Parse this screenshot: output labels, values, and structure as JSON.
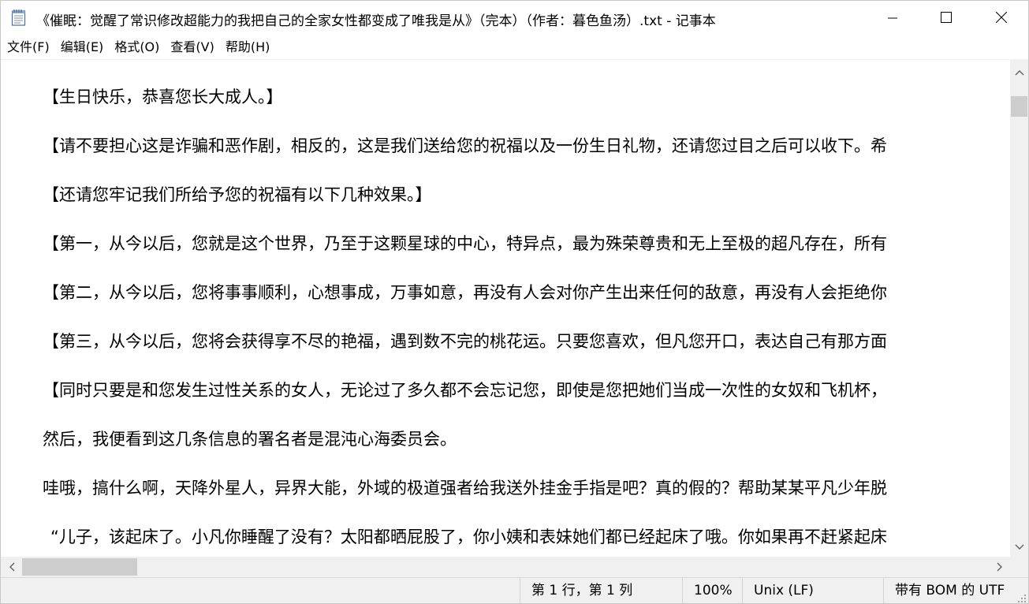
{
  "window": {
    "title": "《催眠：觉醒了常识修改超能力的我把自己的全家女性都变成了唯我是从》（完本）（作者：暮色鱼汤）.txt - 记事本",
    "controls": {
      "minimize": "minimize-icon",
      "maximize": "maximize-icon",
      "close": "close-icon"
    }
  },
  "menu": {
    "items": [
      {
        "label": "文件(F)"
      },
      {
        "label": "编辑(E)"
      },
      {
        "label": "格式(O)"
      },
      {
        "label": "查看(V)"
      },
      {
        "label": "帮助(H)"
      }
    ]
  },
  "editor": {
    "lines": [
      "【生日快乐，恭喜您长大成人。】",
      "【请不要担心这是诈骗和恶作剧，相反的，这是我们送给您的祝福以及一份生日礼物，还请您过目之后可以收下。希",
      "【还请您牢记我们所给予您的祝福有以下几种效果。】",
      "【第一，从今以后，您就是这个世界，乃至于这颗星球的中心，特异点，最为殊荣尊贵和无上至极的超凡存在，所有",
      "【第二，从今以后，您将事事顺利，心想事成，万事如意，再没有人会对你产生出来任何的敌意，再没有人会拒绝你",
      "【第三，从今以后，您将会获得享不尽的艳福，遇到数不完的桃花运。只要您喜欢，但凡您开口，表达自己有那方面",
      "【同时只要是和您发生过性关系的女人，无论过了多久都不会忘记您，即使是您把她们当成一次性的女奴和飞机杯，",
      "然后，我便看到这几条信息的署名者是混沌心海委员会。",
      "哇哦，搞什么啊，天降外星人，异界大能，外域的极道强者给我送外挂金手指是吧？真的假的？帮助某某平凡少年脱",
      "“儿子，该起床了。小凡你睡醒了没有？太阳都晒屁股了，你小姨和表妹她们都已经起床了哦。你如果再不赶紧起床"
    ]
  },
  "statusbar": {
    "position": "第 1 行，第 1 列",
    "zoom": "100%",
    "line_ending": "Unix (LF)",
    "encoding": "带有 BOM 的 UTF"
  }
}
